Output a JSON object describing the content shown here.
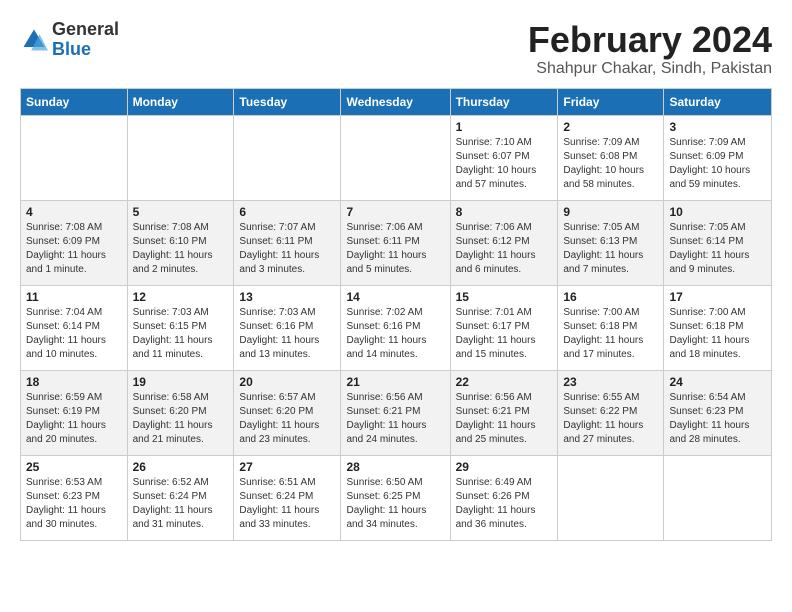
{
  "header": {
    "logo_general": "General",
    "logo_blue": "Blue",
    "month": "February 2024",
    "location": "Shahpur Chakar, Sindh, Pakistan"
  },
  "columns": [
    "Sunday",
    "Monday",
    "Tuesday",
    "Wednesday",
    "Thursday",
    "Friday",
    "Saturday"
  ],
  "weeks": [
    [
      {
        "day": "",
        "info": ""
      },
      {
        "day": "",
        "info": ""
      },
      {
        "day": "",
        "info": ""
      },
      {
        "day": "",
        "info": ""
      },
      {
        "day": "1",
        "info": "Sunrise: 7:10 AM\nSunset: 6:07 PM\nDaylight: 10 hours\nand 57 minutes."
      },
      {
        "day": "2",
        "info": "Sunrise: 7:09 AM\nSunset: 6:08 PM\nDaylight: 10 hours\nand 58 minutes."
      },
      {
        "day": "3",
        "info": "Sunrise: 7:09 AM\nSunset: 6:09 PM\nDaylight: 10 hours\nand 59 minutes."
      }
    ],
    [
      {
        "day": "4",
        "info": "Sunrise: 7:08 AM\nSunset: 6:09 PM\nDaylight: 11 hours\nand 1 minute."
      },
      {
        "day": "5",
        "info": "Sunrise: 7:08 AM\nSunset: 6:10 PM\nDaylight: 11 hours\nand 2 minutes."
      },
      {
        "day": "6",
        "info": "Sunrise: 7:07 AM\nSunset: 6:11 PM\nDaylight: 11 hours\nand 3 minutes."
      },
      {
        "day": "7",
        "info": "Sunrise: 7:06 AM\nSunset: 6:11 PM\nDaylight: 11 hours\nand 5 minutes."
      },
      {
        "day": "8",
        "info": "Sunrise: 7:06 AM\nSunset: 6:12 PM\nDaylight: 11 hours\nand 6 minutes."
      },
      {
        "day": "9",
        "info": "Sunrise: 7:05 AM\nSunset: 6:13 PM\nDaylight: 11 hours\nand 7 minutes."
      },
      {
        "day": "10",
        "info": "Sunrise: 7:05 AM\nSunset: 6:14 PM\nDaylight: 11 hours\nand 9 minutes."
      }
    ],
    [
      {
        "day": "11",
        "info": "Sunrise: 7:04 AM\nSunset: 6:14 PM\nDaylight: 11 hours\nand 10 minutes."
      },
      {
        "day": "12",
        "info": "Sunrise: 7:03 AM\nSunset: 6:15 PM\nDaylight: 11 hours\nand 11 minutes."
      },
      {
        "day": "13",
        "info": "Sunrise: 7:03 AM\nSunset: 6:16 PM\nDaylight: 11 hours\nand 13 minutes."
      },
      {
        "day": "14",
        "info": "Sunrise: 7:02 AM\nSunset: 6:16 PM\nDaylight: 11 hours\nand 14 minutes."
      },
      {
        "day": "15",
        "info": "Sunrise: 7:01 AM\nSunset: 6:17 PM\nDaylight: 11 hours\nand 15 minutes."
      },
      {
        "day": "16",
        "info": "Sunrise: 7:00 AM\nSunset: 6:18 PM\nDaylight: 11 hours\nand 17 minutes."
      },
      {
        "day": "17",
        "info": "Sunrise: 7:00 AM\nSunset: 6:18 PM\nDaylight: 11 hours\nand 18 minutes."
      }
    ],
    [
      {
        "day": "18",
        "info": "Sunrise: 6:59 AM\nSunset: 6:19 PM\nDaylight: 11 hours\nand 20 minutes."
      },
      {
        "day": "19",
        "info": "Sunrise: 6:58 AM\nSunset: 6:20 PM\nDaylight: 11 hours\nand 21 minutes."
      },
      {
        "day": "20",
        "info": "Sunrise: 6:57 AM\nSunset: 6:20 PM\nDaylight: 11 hours\nand 23 minutes."
      },
      {
        "day": "21",
        "info": "Sunrise: 6:56 AM\nSunset: 6:21 PM\nDaylight: 11 hours\nand 24 minutes."
      },
      {
        "day": "22",
        "info": "Sunrise: 6:56 AM\nSunset: 6:21 PM\nDaylight: 11 hours\nand 25 minutes."
      },
      {
        "day": "23",
        "info": "Sunrise: 6:55 AM\nSunset: 6:22 PM\nDaylight: 11 hours\nand 27 minutes."
      },
      {
        "day": "24",
        "info": "Sunrise: 6:54 AM\nSunset: 6:23 PM\nDaylight: 11 hours\nand 28 minutes."
      }
    ],
    [
      {
        "day": "25",
        "info": "Sunrise: 6:53 AM\nSunset: 6:23 PM\nDaylight: 11 hours\nand 30 minutes."
      },
      {
        "day": "26",
        "info": "Sunrise: 6:52 AM\nSunset: 6:24 PM\nDaylight: 11 hours\nand 31 minutes."
      },
      {
        "day": "27",
        "info": "Sunrise: 6:51 AM\nSunset: 6:24 PM\nDaylight: 11 hours\nand 33 minutes."
      },
      {
        "day": "28",
        "info": "Sunrise: 6:50 AM\nSunset: 6:25 PM\nDaylight: 11 hours\nand 34 minutes."
      },
      {
        "day": "29",
        "info": "Sunrise: 6:49 AM\nSunset: 6:26 PM\nDaylight: 11 hours\nand 36 minutes."
      },
      {
        "day": "",
        "info": ""
      },
      {
        "day": "",
        "info": ""
      }
    ]
  ]
}
